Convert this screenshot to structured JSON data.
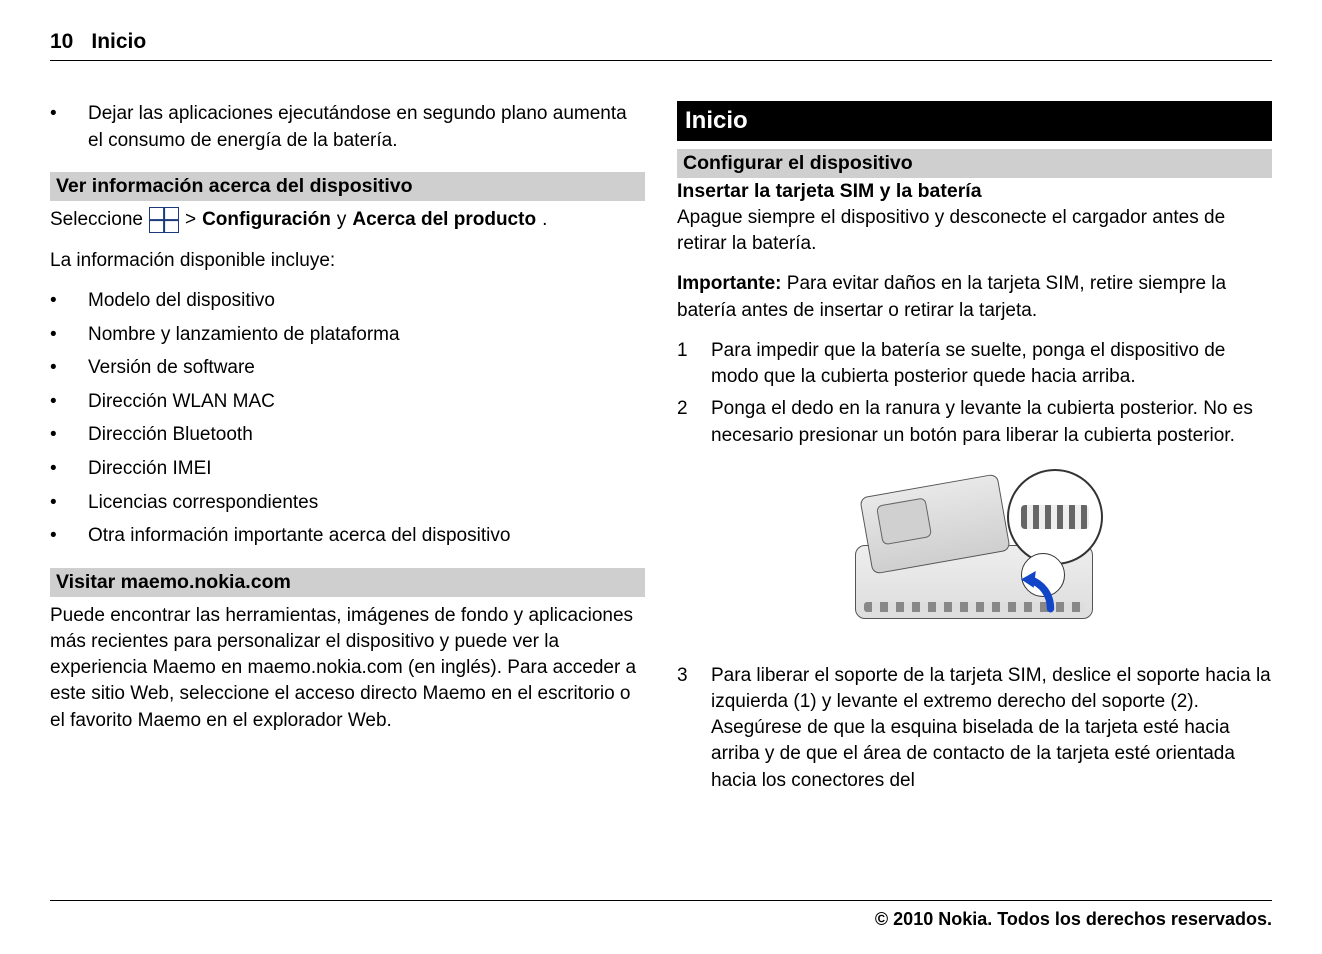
{
  "header": {
    "page_number": "10",
    "title": "Inicio"
  },
  "left": {
    "intro_bullet": "Dejar las aplicaciones ejecutándose en segundo plano aumenta el consumo de energía de la batería.",
    "section1_title": "Ver información acerca del dispositivo",
    "select_prefix": "Seleccione",
    "select_gt": ">",
    "select_bold1": "Configuración",
    "select_y": "y",
    "select_bold2": "Acerca del producto",
    "select_period": ".",
    "info_includes": "La información disponible incluye:",
    "info_list": [
      "Modelo del dispositivo",
      "Nombre y lanzamiento de plataforma",
      "Versión de software",
      "Dirección WLAN MAC",
      "Dirección Bluetooth",
      "Dirección IMEI",
      "Licencias correspondientes",
      "Otra información importante acerca del dispositivo"
    ],
    "section2_title": "Visitar maemo.nokia.com",
    "section2_body": "Puede encontrar las herramientas, imágenes de fondo y aplicaciones más recientes para personalizar el dispositivo y puede ver la experiencia Maemo en maemo.nokia.com (en inglés). Para acceder a este sitio Web, seleccione el acceso directo Maemo en el escritorio o el favorito Maemo en el explorador Web."
  },
  "right": {
    "black_title": "Inicio",
    "gray_subtitle": "Configurar el dispositivo",
    "bold_line": "Insertar la tarjeta SIM y la batería",
    "para1": "Apague siempre el dispositivo y desconecte el cargador antes de retirar la batería.",
    "important_label": "Importante:",
    "important_body": "Para evitar daños en la tarjeta SIM, retire siempre la batería antes de insertar o retirar la tarjeta.",
    "steps": [
      {
        "n": "1",
        "t": "Para impedir que la batería se suelte, ponga el dispositivo de modo que la cubierta posterior quede hacia arriba."
      },
      {
        "n": "2",
        "t": "Ponga el dedo en la ranura y levante la cubierta posterior. No es necesario presionar un botón para liberar la cubierta posterior."
      }
    ],
    "step3": {
      "n": "3",
      "t": "Para liberar el soporte de la tarjeta SIM, deslice el soporte hacia la izquierda (1) y levante el extremo derecho del soporte (2). Asegúrese de que la esquina biselada de la tarjeta esté hacia arriba y de que el área de contacto de la tarjeta esté orientada hacia los conectores del"
    }
  },
  "footer": "© 2010 Nokia. Todos los derechos reservados."
}
